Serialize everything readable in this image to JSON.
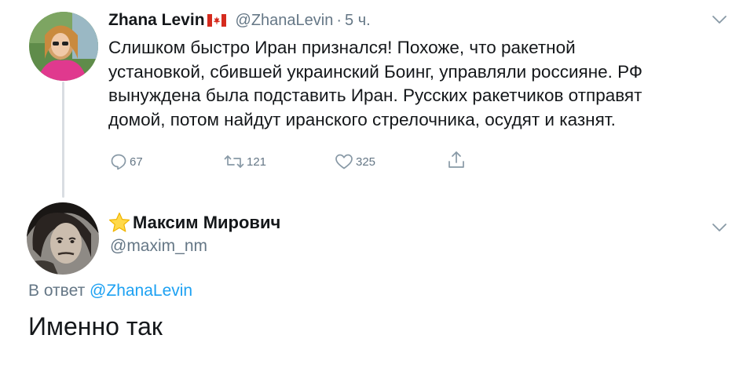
{
  "tweet1": {
    "author_name": "Zhana Levin",
    "handle": "@ZhanaLevin",
    "separator": "·",
    "time": "5 ч.",
    "flag_icon": "canada-flag-icon",
    "avatar_icon": "user-avatar",
    "lines": [
      "Слишком быстро Иран признался! Похоже, что ракетной",
      "установкой, сбившей украинский Боинг, управляли россияне. РФ",
      "вынуждена была подставить Иран. Русских ракетчиков отправят",
      "домой, потом найдут иранского стрелочника, осудят и казнят."
    ],
    "actions": {
      "reply_count": "67",
      "retweet_count": "121",
      "like_count": "325"
    }
  },
  "tweet2": {
    "author_name": "Максим Мирович",
    "handle": "@maxim_nm",
    "reply_prefix": "В ответ",
    "reply_handle": "@ZhanaLevin",
    "text": "Именно так",
    "star_icon": "star-emoji-icon",
    "avatar_icon": "user-avatar"
  },
  "colors": {
    "text": "#14171a",
    "secondary": "#657786",
    "link": "#1da1f2",
    "thread_line": "#d9dde2",
    "icon": "#8899a6"
  }
}
